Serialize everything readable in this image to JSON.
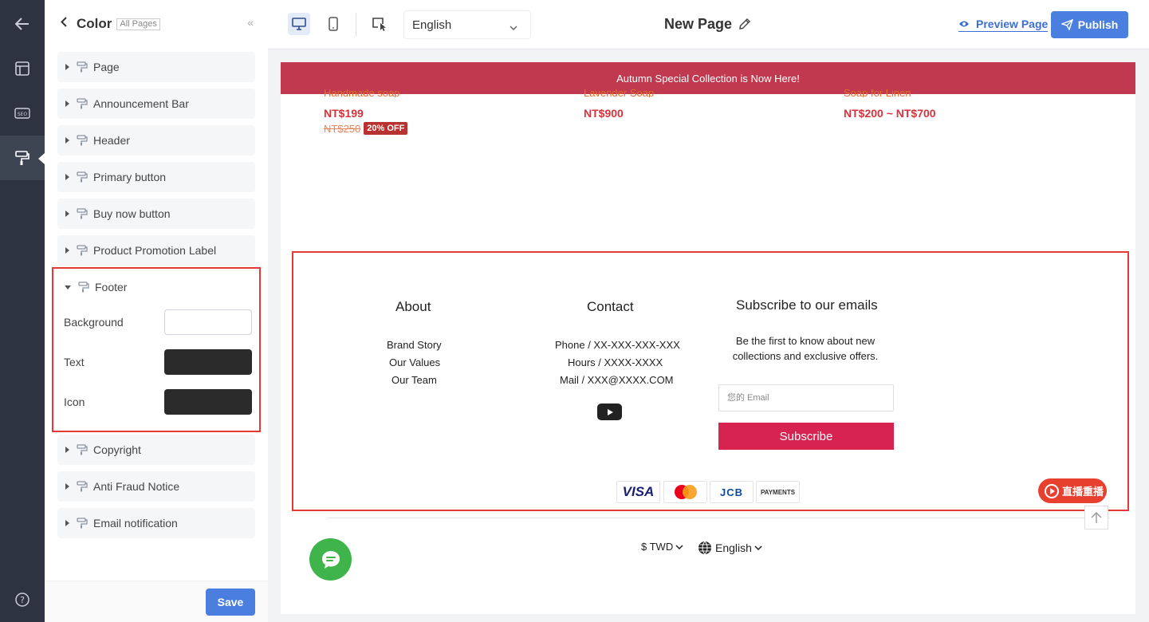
{
  "panel": {
    "title": "Color",
    "scope_badge": "All Pages",
    "sections": [
      "Page",
      "Announcement Bar",
      "Header",
      "Primary button",
      "Buy now button",
      "Product Promotion Label"
    ],
    "footer": {
      "label": "Footer",
      "rows": [
        {
          "label": "Background",
          "color": "#ffffff"
        },
        {
          "label": "Text",
          "color": "#2b2b2b"
        },
        {
          "label": "Icon",
          "color": "#2b2b2b"
        }
      ]
    },
    "sections_after": [
      "Copyright",
      "Anti Fraud Notice",
      "Email notification"
    ],
    "save_label": "Save"
  },
  "topbar": {
    "language": "English",
    "page_name": "New Page",
    "preview_label": "Preview Page",
    "publish_label": "Publish"
  },
  "canvas": {
    "announcement": "Autumn Special Collection is Now Here!",
    "products": [
      {
        "name": "Handmade soap",
        "price": "NT$199",
        "old_price": "NT$250",
        "badge": "20% OFF"
      },
      {
        "name": "Lavender Soap",
        "price": "NT$900"
      },
      {
        "name": "Soap for Linen",
        "price": "NT$200 ~ NT$700"
      }
    ],
    "footer": {
      "about_title": "About",
      "about_links": [
        "Brand Story",
        "Our Values",
        "Our Team"
      ],
      "contact_title": "Contact",
      "contact_lines": [
        "Phone / XX-XXX-XXX-XXX",
        "Hours / XXXX-XXXX",
        "Mail / XXX@XXXX.COM"
      ],
      "subscribe_title": "Subscribe to our emails",
      "subscribe_desc": "Be the first to know about new collections and exclusive offers.",
      "email_placeholder": "您的 Email",
      "subscribe_button": "Subscribe",
      "payments": [
        "VISA",
        "JCB",
        "PAYMENTS"
      ],
      "live_badge": "直播重播"
    },
    "currency": "$ TWD",
    "footer_language": "English"
  },
  "colors": {
    "accent": "#4a7fe0",
    "announcement_bg": "#c0394f",
    "subscribe_bg": "#d7234f",
    "highlight_border": "#e53935",
    "chat_fab": "#3fb44a"
  }
}
